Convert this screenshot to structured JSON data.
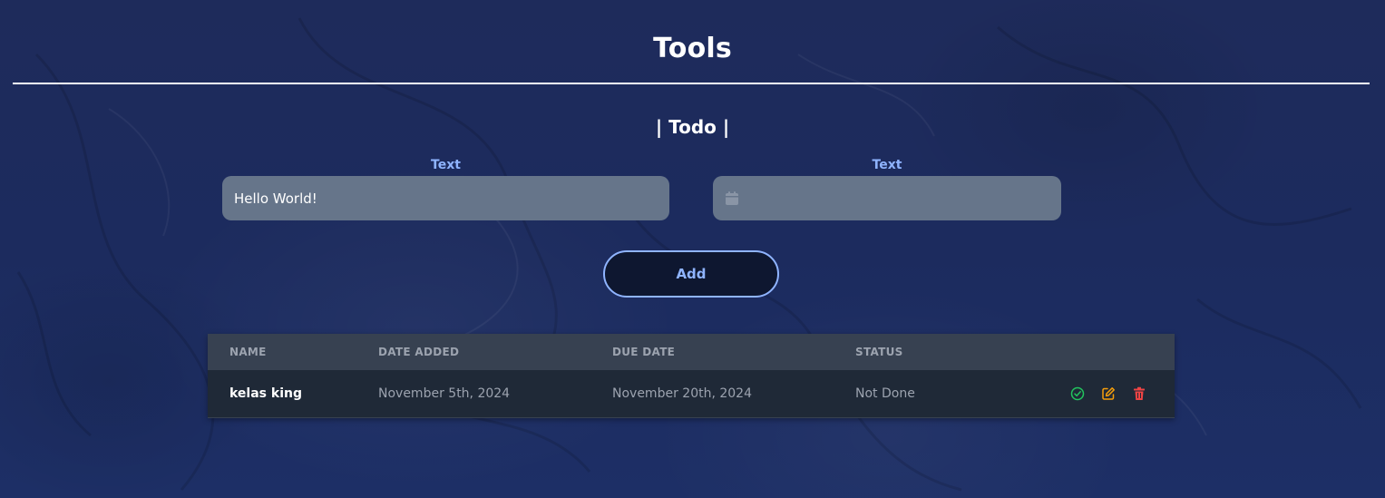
{
  "page": {
    "title": "Tools",
    "section_title": "| Todo |"
  },
  "form": {
    "text_label": "Text",
    "text_value": "Hello World!",
    "date_label": "Text",
    "date_value": "",
    "add_label": "Add"
  },
  "table": {
    "headers": [
      "Name",
      "Date Added",
      "Due Date",
      "Status"
    ],
    "rows": [
      {
        "name": "kelas king",
        "date_added": "November 5th, 2024",
        "due_date": "November 20th, 2024",
        "status": "Not Done",
        "actions": [
          "check-circle-icon",
          "edit-icon",
          "trash-icon"
        ]
      }
    ]
  },
  "colors": {
    "background": "#1d2b5c",
    "accent": "#8fb4ff",
    "input_bg": "#66758a",
    "table_header_bg": "#374151",
    "table_row_bg": "#1f2937",
    "done_icon": "#22c55e",
    "edit_icon": "#f59e0b",
    "delete_icon": "#ef4444"
  }
}
